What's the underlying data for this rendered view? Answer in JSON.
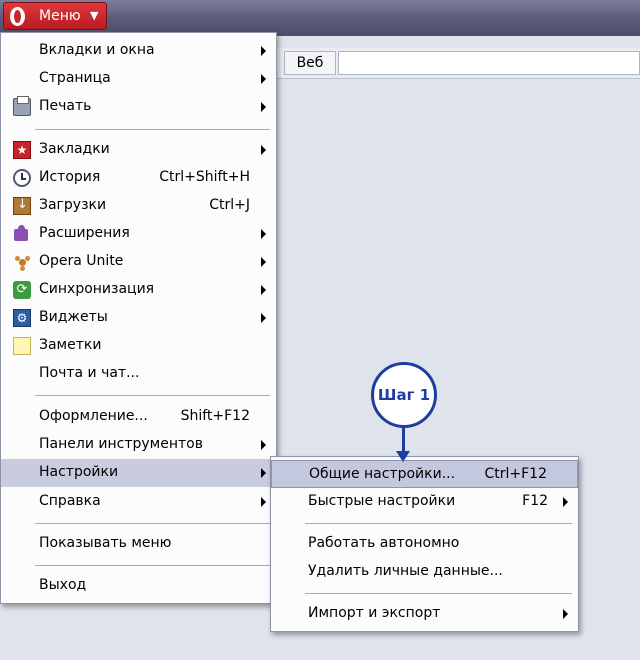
{
  "titlebar": {
    "menu_button": "Меню"
  },
  "tabs": [
    {
      "label": "Веб"
    }
  ],
  "main_menu": {
    "items": [
      {
        "label": "Вкладки и окна",
        "submenu": true
      },
      {
        "label": "Страница",
        "submenu": true
      },
      {
        "label": "Печать",
        "submenu": true,
        "icon": "printer-icon"
      },
      {
        "label": "Закладки",
        "submenu": true,
        "icon": "bookmarks-icon"
      },
      {
        "label": "История",
        "shortcut": "Ctrl+Shift+H",
        "icon": "history-clock-icon"
      },
      {
        "label": "Загрузки",
        "shortcut": "Ctrl+J",
        "icon": "downloads-icon"
      },
      {
        "label": "Расширения",
        "submenu": true,
        "icon": "extensions-puzzle-icon"
      },
      {
        "label": "Opera Unite",
        "submenu": true,
        "icon": "opera-unite-icon"
      },
      {
        "label": "Синхронизация",
        "submenu": true,
        "icon": "sync-icon"
      },
      {
        "label": "Виджеты",
        "submenu": true,
        "icon": "widgets-icon"
      },
      {
        "label": "Заметки",
        "icon": "notes-icon"
      },
      {
        "label": "Почта и чат..."
      },
      {
        "label": "Оформление...",
        "shortcut": "Shift+F12"
      },
      {
        "label": "Панели инструментов",
        "submenu": true
      },
      {
        "label": "Настройки",
        "submenu": true,
        "highlighted": true
      },
      {
        "label": "Справка",
        "submenu": true
      },
      {
        "label": "Показывать меню"
      },
      {
        "label": "Выход"
      }
    ]
  },
  "settings_submenu": {
    "items": [
      {
        "label": "Общие настройки...",
        "shortcut": "Ctrl+F12",
        "highlighted": true
      },
      {
        "label": "Быстрые настройки",
        "shortcut": "F12",
        "submenu": true
      },
      {
        "label": "Работать автономно"
      },
      {
        "label": "Удалить личные данные..."
      },
      {
        "label": "Импорт и экспорт",
        "submenu": true
      }
    ]
  },
  "annotation": {
    "text": "Шаг 1"
  },
  "colors": {
    "menu_button": "#c3262c",
    "highlight": "#c9ccdf",
    "callout": "#1f3d9e"
  }
}
